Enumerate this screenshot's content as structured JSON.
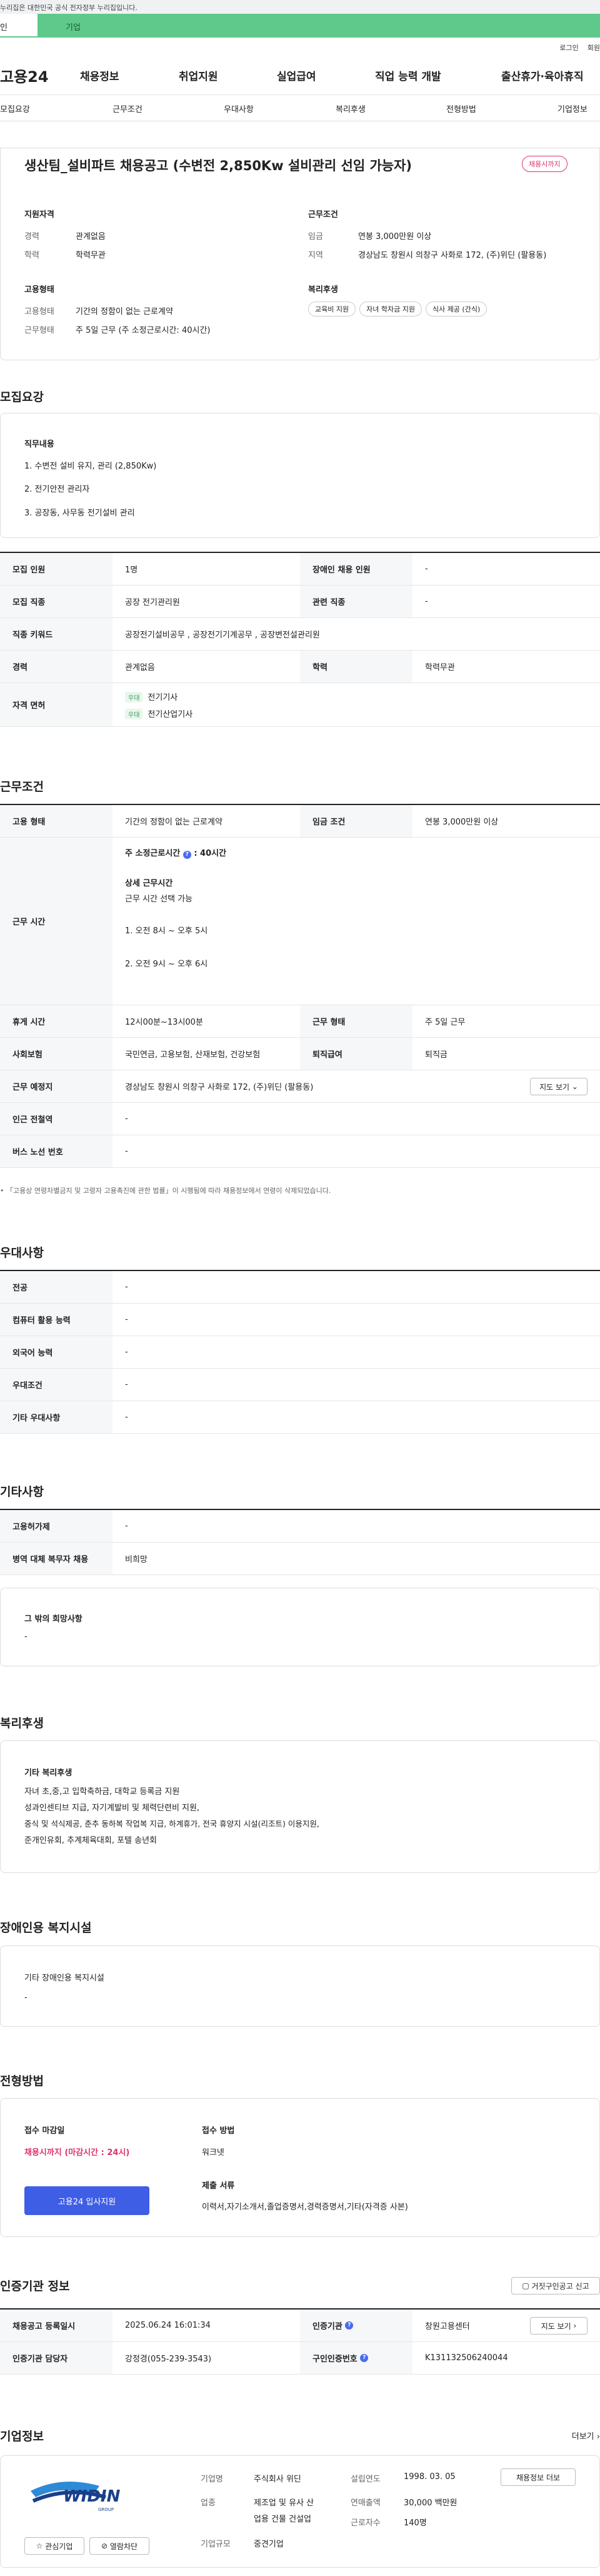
{
  "gov_notice": "누리집은 대한민국 공식 전자정부 누리집입니다.",
  "tabs": {
    "personal": "인",
    "company": "기업"
  },
  "util": {
    "login": "로그인",
    "join": "회원"
  },
  "logo": "고용24",
  "gnb": [
    "채용정보",
    "취업지원",
    "실업급여",
    "직업 능력 개발",
    "출산휴가·육아휴직"
  ],
  "subnav": [
    "모집요강",
    "근무조건",
    "우대사항",
    "복리후생",
    "전형방법",
    "기업정보"
  ],
  "title": "생산팀_설비파트 채용공고 (수변전 2,850Kw 설비관리 선임 가능자)",
  "status_badge": "채용시까지",
  "summary": {
    "qual_title": "지원자격",
    "career_l": "경력",
    "career_v": "관계없음",
    "edu_l": "학력",
    "edu_v": "학력무관",
    "emp_title": "고용형태",
    "emptype_l": "고용형태",
    "emptype_v": "기간의 정함이 없는 근로계약",
    "worktype_l": "근무형태",
    "worktype_v": "주 5일 근무 (주 소정근로시간: 40시간)",
    "cond_title": "근무조건",
    "wage_l": "임금",
    "wage_v": "연봉 3,000만원 이상",
    "loc_l": "지역",
    "loc_v": "경상남도 창원시 의창구 사화로 172, (주)위딘 (팔용동)",
    "welfare_title": "복리후생",
    "welfare_tags": [
      "교육비 지원",
      "자녀 학자금 지원",
      "식사 제공 (간식)"
    ]
  },
  "recruit": {
    "heading": "모집요강",
    "duty_title": "직무내용",
    "duties": [
      "1. 수변전 설비 유지, 관리 (2,850Kw)",
      "2. 전기안전 관리자",
      "3. 공장동, 사무동 전기설비 관리"
    ],
    "rows": [
      {
        "k1": "모집 인원",
        "v1": "1명",
        "k2": "장애인 채용 인원",
        "v2": "-"
      },
      {
        "k1": "모집 직종",
        "v1": "공장 전기관리원",
        "k2": "관련 직종",
        "v2": "-"
      }
    ],
    "keyword_l": "직종 키워드",
    "keyword_v": "공장전기설비공무 , 공장전기기계공무 , 공장변전설관리원",
    "career_l": "경력",
    "career_v": "관계없음",
    "edu_l": "학력",
    "edu_v": "학력무관",
    "license_l": "자격 면허",
    "license_chip": "우대",
    "licenses": [
      "전기기사",
      "전기산업기사"
    ]
  },
  "work": {
    "heading": "근무조건",
    "emp_l": "고용 형태",
    "emp_v": "기간의 정함이 없는 근로계약",
    "wage_l": "임금 조건",
    "wage_v": "연봉 3,000만원 이상",
    "time_l": "근무 시간",
    "weekly": "주 소정근로시간",
    "weekly_v": ": 40시간",
    "detail_t": "상세 근무시간",
    "detail_s": "근무 시간 선택 가능",
    "shift1": "1. 오전 8시 ~ 오후 5시",
    "shift2": "2. 오전 9시 ~ 오후 6시",
    "rest_l": "휴게 시간",
    "rest_v": "12시00분~13시00분",
    "form_l": "근무 형태",
    "form_v": "주 5일 근무",
    "ins_l": "사회보험",
    "ins_v": "국민연금, 고용보험, 산재보험, 건강보험",
    "sev_l": "퇴직급여",
    "sev_v": "퇴직금",
    "place_l": "근무 예정지",
    "place_v": "경상남도 창원시 의창구 사화로 172, (주)위딘 (팔용동)",
    "map_btn": "지도 보기",
    "subway_l": "인근 전철역",
    "subway_v": "-",
    "bus_l": "버스 노선 번호",
    "bus_v": "-",
    "footnote": "「고용상 연령차별금지 및 고령자 고용촉진에 관한 법률」이 시행됨에 따라 채용정보에서 연령이 삭제되었습니다."
  },
  "pref": {
    "heading": "우대사항",
    "rows": [
      [
        "전공",
        "-"
      ],
      [
        "컴퓨터 활용 능력",
        "-"
      ],
      [
        "외국어 능력",
        "-"
      ],
      [
        "우대조건",
        "-"
      ],
      [
        "기타 우대사항",
        "-"
      ]
    ]
  },
  "etc": {
    "heading": "기타사항",
    "rows": [
      [
        "고용허가제",
        "-"
      ],
      [
        "병역 대체 복무자 채용",
        "비희망"
      ]
    ],
    "other_title": "그 밖의 희망사항",
    "other_v": "-"
  },
  "welfare": {
    "heading": "복리후생",
    "title": "기타 복리후생",
    "lines": [
      "자녀 초,중,고 입학축하금, 대학교 등록금 지원",
      "성과인센티브 지급, 자기계발비 및 체력단련비 지원,",
      "중식 및 석식제공, 춘추 동하복 작업복 지급, 하계휴가, 전국 휴양지 시설(리조트) 이용지원,",
      "준개인유회, 추계체육대회, 포텔 송년회"
    ]
  },
  "disab": {
    "heading": "장애인용 복지시설",
    "title": "기타 장애인용 복지시설",
    "value": "-"
  },
  "process": {
    "heading": "전형방법",
    "deadline_l": "접수 마감일",
    "deadline_v": "채용시까지 (마감시간 : 24시)",
    "apply_btn": "고용24 입사지원",
    "method_l": "접수 방법",
    "method_v": "워크넷",
    "docs_l": "제출 서류",
    "docs_v": "이력서,자기소개서,졸업증명서,경력증명서,기타(자격증 사본)"
  },
  "cert": {
    "heading": "인증기관 정보",
    "report_btn": "거짓구인공고 신고",
    "reg_l": "채용공고 등록일시",
    "reg_v": "2025.06.24 16:01:34",
    "org_l": "인증기관",
    "org_v": "창원고용센터",
    "map_btn": "지도 보기",
    "mgr_l": "인증기관 담당자",
    "mgr_v": "강정경(055-239-3543)",
    "no_l": "구인인증번호",
    "no_v": "K131132506240044"
  },
  "company": {
    "heading": "기업정보",
    "more": "더보기",
    "logo_text": "WIDIN",
    "logo_sub": "GROUP",
    "fav_btn": "관심기업",
    "block_btn": "열람차단",
    "name_l": "기업명",
    "name_v": "주식회사 위딘",
    "ind_l": "업종",
    "ind_v1": "제조업 및 유사 산",
    "ind_v2": "업용 건물 건설업",
    "size_l": "기업규모",
    "size_v": "중견기업",
    "est_l": "설립연도",
    "est_v": "1998. 03. 05",
    "sales_l": "연매출액",
    "sales_v": "30,000 백만원",
    "emp_l": "근로자수",
    "emp_v": "140명",
    "jobs_btn": "채용정보 더보"
  }
}
